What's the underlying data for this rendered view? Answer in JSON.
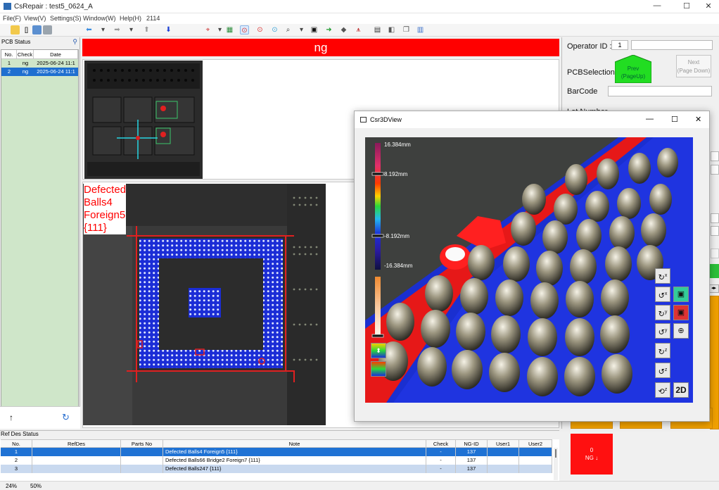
{
  "window": {
    "title": "CsRepair : test5_0624_A",
    "minimize": "—",
    "maximize": "☐",
    "close": "✕"
  },
  "menu": {
    "items": [
      "File(F)",
      "View(V)",
      "Settings(S)",
      "Window(W)",
      "Help(H)",
      "2114"
    ]
  },
  "pcb_status": {
    "title": "PCB Status",
    "columns": [
      "No.",
      "Check",
      "Date"
    ],
    "rows": [
      {
        "no": "1",
        "check": "ng",
        "date": "2025-06-24 11:1"
      },
      {
        "no": "2",
        "check": "ng",
        "date": "2025-06-24 11:1"
      }
    ],
    "up_arrow": "↑",
    "refresh": "↻"
  },
  "result_banner": "ng",
  "defect_label": {
    "line1": "Defected",
    "line2": "Balls4",
    "line3": "Foreign5",
    "line4": "{111}"
  },
  "right": {
    "operator_label": "Operator ID :",
    "operator_value": "1",
    "pcb_selection_label": "PCBSelection",
    "prev_line1": "Prev",
    "prev_line2": "(PageUp)",
    "next_line1": "Next",
    "next_line2": "(Page Down)",
    "barcode_label": "BarCode",
    "lot_label": "Lot Number",
    "ng_count": "0",
    "ng_label": "NG ↓"
  },
  "view3d": {
    "title": "Csr3DView",
    "scale_labels": [
      "16.384mm",
      "8.192mm",
      "-8.192mm",
      "-16.384mm"
    ],
    "controls": [
      "2D"
    ]
  },
  "ref_des": {
    "title": "Ref Des Status",
    "columns": [
      "No.",
      "RefDes",
      "Parts No",
      "Note",
      "Check",
      "NG-ID",
      "User1",
      "User2"
    ],
    "rows": [
      {
        "no": "1",
        "refdes": "",
        "parts": "",
        "note": "Defected Balls4 Foreign5 {111}",
        "check": "-",
        "ngid": "137",
        "u1": "",
        "u2": ""
      },
      {
        "no": "2",
        "refdes": "",
        "parts": "",
        "note": "Defected Balls66 Bridge2 Foreign7 {111}",
        "check": "-",
        "ngid": "137",
        "u1": "",
        "u2": ""
      },
      {
        "no": "3",
        "refdes": "",
        "parts": "",
        "note": "Defected Balls247 {111}",
        "check": "-",
        "ngid": "137",
        "u1": "",
        "u2": ""
      }
    ]
  },
  "status_bar": {
    "left": "24%",
    "right": "50%"
  },
  "colors": {
    "ng_red": "#ff0000",
    "selection_blue": "#1f72d4",
    "pcb_green": "#cfe6c9",
    "prev_green": "#22dd22",
    "orange": "#f0a000"
  }
}
